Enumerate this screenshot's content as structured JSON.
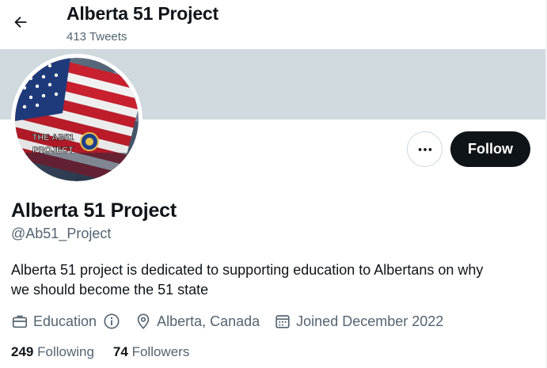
{
  "header": {
    "title": "Alberta 51 Project",
    "tweet_count": "413 Tweets"
  },
  "avatar": {
    "badge_line1": "THE AB51",
    "badge_line2": "PROJECT"
  },
  "actions": {
    "more_icon": "more-horizontal-icon",
    "follow_label": "Follow"
  },
  "profile": {
    "name": "Alberta 51 Project",
    "handle": "@Ab51_Project",
    "bio_line1": "Alberta 51 project is dedicated to supporting education to Albertans on why",
    "bio_line2": "we should become the 51 state",
    "category": "Education",
    "location": "Alberta, Canada",
    "joined": "Joined December 2022"
  },
  "stats": {
    "following_count": "249",
    "following_label": "Following",
    "followers_count": "74",
    "followers_label": "Followers"
  },
  "colors": {
    "text_primary": "#0f1419",
    "text_secondary": "#536471",
    "banner": "#cfd9de",
    "button_dark": "#0f1419"
  }
}
